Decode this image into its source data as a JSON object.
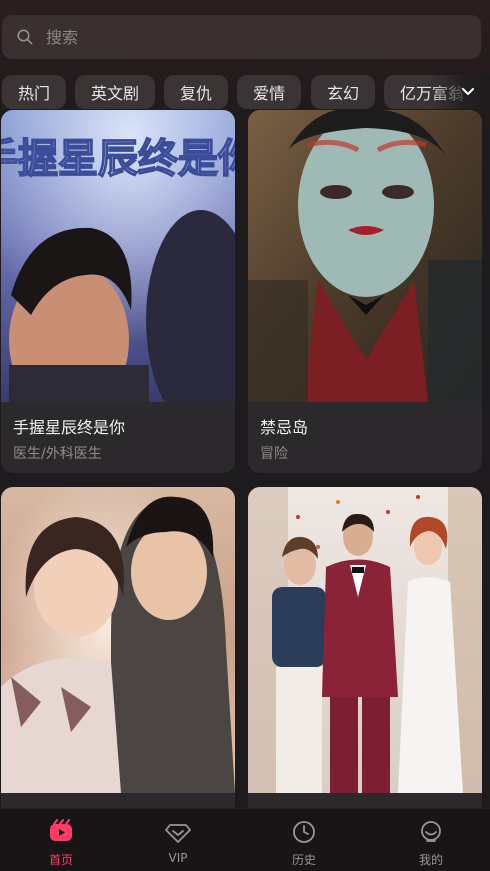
{
  "search": {
    "placeholder": "搜索"
  },
  "categories": [
    "热门",
    "英文剧",
    "复仇",
    "爱情",
    "玄幻",
    "亿万富翁"
  ],
  "cards": [
    {
      "poster_text": "手握星辰终是你",
      "title": "手握星辰终是你",
      "tag": "医生/外科医生"
    },
    {
      "title": "禁忌岛",
      "tag": "冒险"
    },
    {
      "title": "",
      "tag": ""
    },
    {
      "title": "",
      "tag": ""
    }
  ],
  "nav": {
    "home": "首页",
    "vip": "VIP",
    "history": "历史",
    "mine": "我的"
  },
  "colors": {
    "accent": "#ff3b67",
    "background": "#1d1b1d",
    "card": "#2b292b"
  }
}
